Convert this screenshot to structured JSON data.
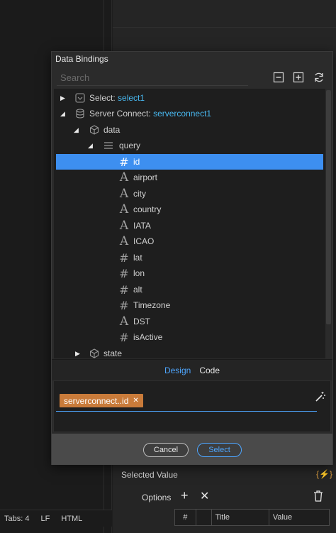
{
  "dialog": {
    "title": "Data Bindings",
    "search_placeholder": "Search",
    "tree": [
      {
        "kind": "select",
        "arrow": "collapsed",
        "label": "Select:",
        "value": "select1"
      },
      {
        "kind": "server",
        "arrow": "expanded",
        "label": "Server Connect:",
        "value": "serverconnect1"
      },
      {
        "kind": "cube",
        "arrow": "expanded",
        "label": "data"
      },
      {
        "kind": "list",
        "arrow": "expanded",
        "label": "query"
      },
      {
        "kind": "number",
        "label": "id",
        "selected": true
      },
      {
        "kind": "text",
        "label": "airport"
      },
      {
        "kind": "text",
        "label": "city"
      },
      {
        "kind": "text",
        "label": "country"
      },
      {
        "kind": "text",
        "label": "IATA"
      },
      {
        "kind": "text",
        "label": "ICAO"
      },
      {
        "kind": "number",
        "label": "lat"
      },
      {
        "kind": "number",
        "label": "lon"
      },
      {
        "kind": "number",
        "label": "alt"
      },
      {
        "kind": "number",
        "label": "Timezone"
      },
      {
        "kind": "text",
        "label": "DST"
      },
      {
        "kind": "number",
        "label": "isActive"
      },
      {
        "kind": "cube",
        "arrow": "collapsed",
        "label": "state"
      }
    ],
    "tabs": {
      "design": "Design",
      "code": "Code"
    },
    "binding_chip": "serverconnect..id",
    "cancel_label": "Cancel",
    "select_label": "Select"
  },
  "statusbar": {
    "tabs": "Tabs: 4",
    "eol": "LF",
    "lang": "HTML"
  },
  "properties": {
    "selected_value_label": "Selected Value",
    "options_label": "Options",
    "table_headers": [
      "#",
      "",
      "Title",
      "Value"
    ]
  },
  "colors": {
    "accent": "#3d8ff0",
    "binding": "#48b8f0",
    "chip": "#c97b3a"
  }
}
